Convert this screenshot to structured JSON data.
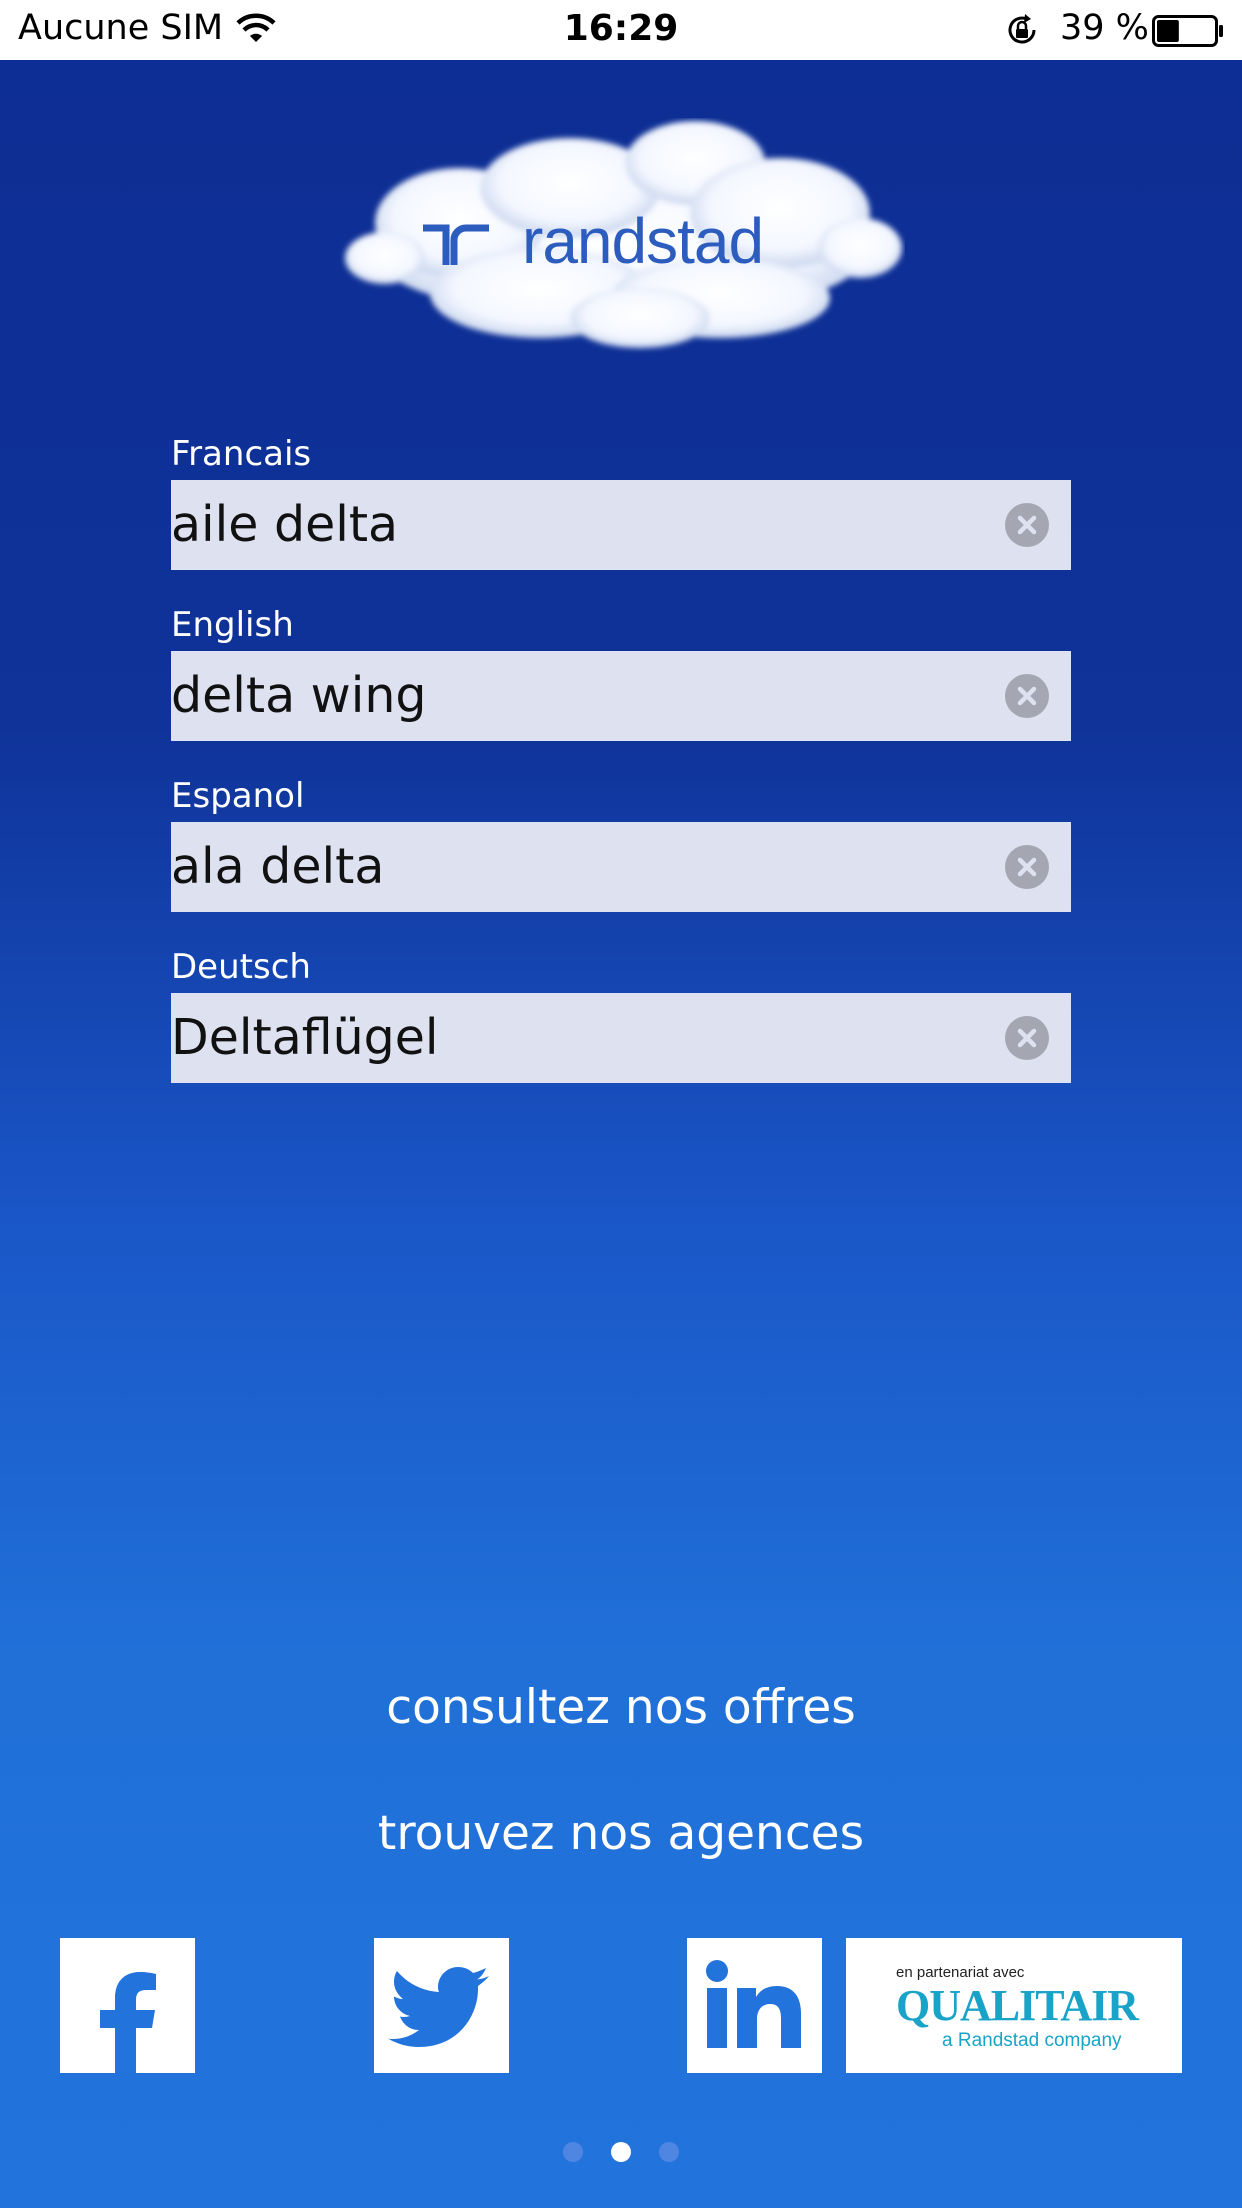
{
  "status_bar": {
    "carrier": "Aucune SIM",
    "time": "16:29",
    "battery": "39 %",
    "battery_level": 0.39
  },
  "logo": {
    "text": "randstad",
    "icon": "randstad-logo-icon",
    "color": "#2b5cbe"
  },
  "fields": [
    {
      "label": "Francais",
      "value": "aile delta"
    },
    {
      "label": "English",
      "value": "delta wing"
    },
    {
      "label": "Espanol",
      "value": "ala delta"
    },
    {
      "label": "Deutsch",
      "value": "Deltaflügel"
    }
  ],
  "links": {
    "offers": "consultez nos offres",
    "agencies": "trouvez nos agences"
  },
  "social": {
    "facebook_icon": "facebook-icon",
    "twitter_icon": "twitter-icon",
    "linkedin_icon": "linkedin-icon"
  },
  "partner": {
    "small": "en partenariat avec",
    "brand": "QUALITAIR",
    "tagline": "a Randstad company",
    "color": "#1aa3c8"
  },
  "pager": {
    "count": 3,
    "active_index": 1
  },
  "colors": {
    "background_top": "#0d2d93",
    "background_bottom": "#2273dc",
    "field_bg": "#dde1f0"
  }
}
